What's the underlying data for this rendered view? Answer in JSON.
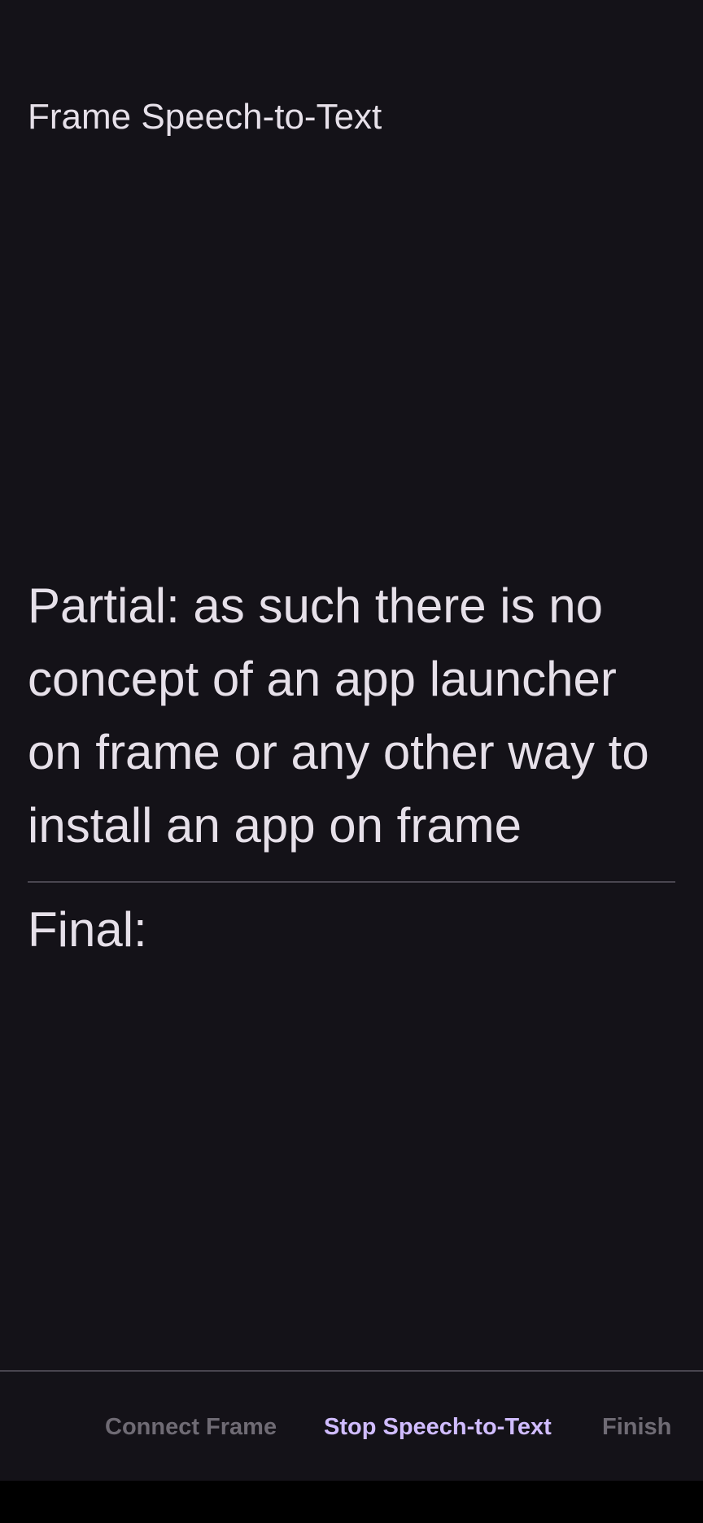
{
  "app_bar": {
    "title": "Frame Speech-to-Text"
  },
  "transcript": {
    "partial": "Partial: as such there is no concept of an app launcher on frame or any other way to install an app on frame",
    "final": "Final:"
  },
  "actions": {
    "connect_label": "Connect Frame",
    "stop_label": "Stop Speech-to-Text",
    "finish_label": "Finish"
  },
  "colors": {
    "background": "#141218",
    "text": "#e6e0e9",
    "accent": "#d0bcff",
    "disabled": "#6f6b74"
  }
}
